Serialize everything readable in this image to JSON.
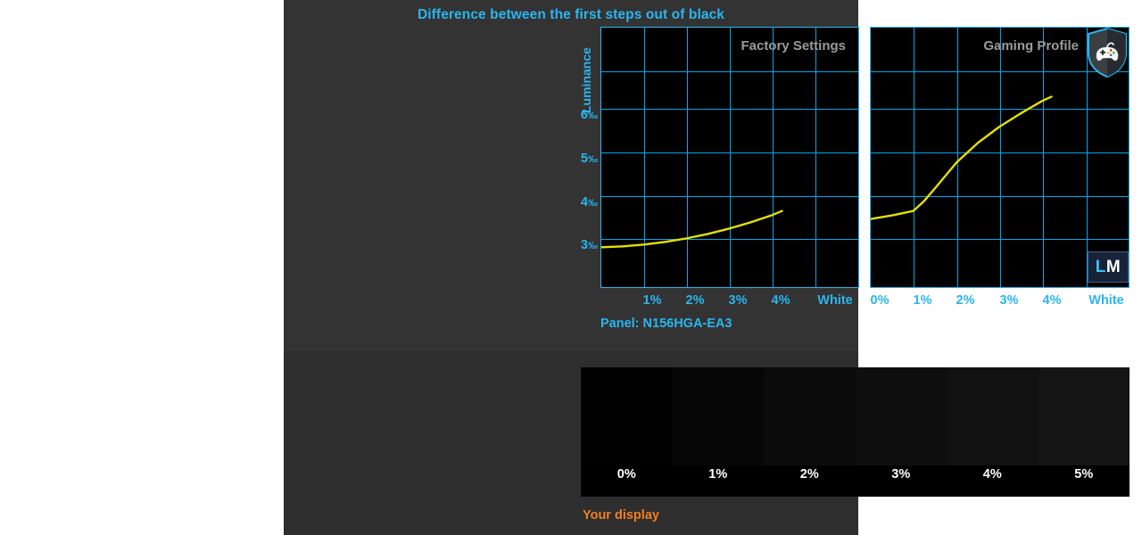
{
  "chart_data": [
    {
      "type": "line",
      "title": "Factory Settings",
      "xlabel": "",
      "ylabel": "Luminance",
      "x_tick_labels": [
        "1%",
        "2%",
        "3%",
        "4%",
        "White"
      ],
      "y_tick_labels": [
        "3‰",
        "4‰",
        "5‰",
        "6‰"
      ],
      "y_tick_values": [
        3,
        4,
        5,
        6
      ],
      "ylim": [
        2.0,
        7.0
      ],
      "grid": true,
      "legend": "none",
      "series": [
        {
          "name": "Factory Settings",
          "color": "#e8e000",
          "x": [
            0,
            1,
            2,
            3,
            4
          ],
          "values": [
            3.02,
            3.08,
            3.2,
            3.38,
            3.62
          ]
        }
      ]
    },
    {
      "type": "line",
      "title": "Gaming Profile",
      "xlabel": "",
      "ylabel": "Luminance",
      "x_tick_labels": [
        "0%",
        "1%",
        "2%",
        "3%",
        "4%",
        "White"
      ],
      "y_tick_labels": [
        "3‰",
        "4‰",
        "5‰",
        "6‰"
      ],
      "y_tick_values": [
        3,
        4,
        5,
        6
      ],
      "ylim": [
        2.0,
        7.0
      ],
      "grid": true,
      "legend": "none",
      "series": [
        {
          "name": "Gaming Profile",
          "color": "#e8e000",
          "x": [
            0,
            1,
            2,
            3,
            4
          ],
          "values": [
            3.7,
            3.95,
            4.95,
            5.7,
            6.3
          ]
        }
      ]
    }
  ],
  "header": {
    "title": "Difference between the first steps out of black"
  },
  "axis": {
    "y_label": "Luminance",
    "y_ticks": [
      {
        "value": "6",
        "unit": "‰"
      },
      {
        "value": "5",
        "unit": "‰"
      },
      {
        "value": "4",
        "unit": "‰"
      },
      {
        "value": "3",
        "unit": "‰"
      }
    ]
  },
  "left_chart": {
    "tag": "Factory Settings",
    "x_ticks": [
      "1%",
      "2%",
      "3%",
      "4%",
      "White"
    ]
  },
  "right_chart": {
    "tag": "Gaming Profile",
    "x_ticks": [
      "0%",
      "1%",
      "2%",
      "3%",
      "4%",
      "White"
    ],
    "badge_icon": "gaming-shield-icon"
  },
  "panel_info": {
    "label": "Panel: N156HGA-EA3"
  },
  "watermark": {
    "letter_1": "L",
    "letter_2": "M",
    "icon": "laptopmedia-logo"
  },
  "gradient_strip": {
    "caption": "Your display",
    "steps": [
      {
        "label": "0%",
        "color": "#010101"
      },
      {
        "label": "1%",
        "color": "#060606"
      },
      {
        "label": "2%",
        "color": "#0b0b0b"
      },
      {
        "label": "3%",
        "color": "#0e0e0e"
      },
      {
        "label": "4%",
        "color": "#111111"
      },
      {
        "label": "5%",
        "color": "#141414"
      }
    ]
  },
  "colors": {
    "accent_cyan": "#29b6f0",
    "grid_cyan": "#00a8e8",
    "curve_yellow": "#e8e000",
    "panel_bg": "#333333",
    "caption_orange": "#f08022",
    "tag_gray": "#9a9a9a"
  }
}
